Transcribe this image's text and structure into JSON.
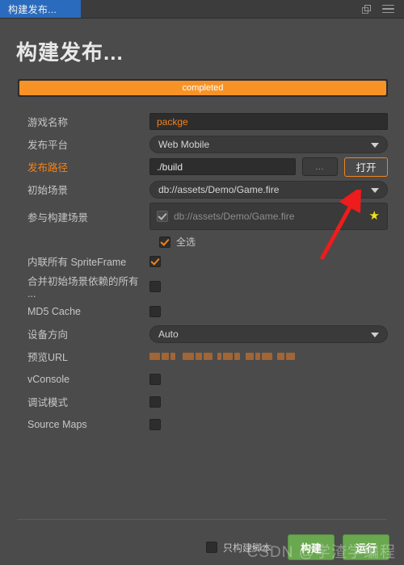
{
  "window": {
    "tab_label": "构建发布...",
    "popout_icon": "popout-icon",
    "menu_icon": "hamburger-menu-icon"
  },
  "header": {
    "title": "构建发布...",
    "progress": {
      "label": "completed",
      "percent": 100,
      "color": "#f79326"
    }
  },
  "form": {
    "game_name": {
      "label": "游戏名称",
      "value": "packge"
    },
    "platform": {
      "label": "发布平台",
      "value": "Web Mobile"
    },
    "build_path": {
      "label": "发布路径",
      "value": "./build",
      "browse_label": "...",
      "open_label": "打开",
      "label_color": "#f0821e"
    },
    "start_scene": {
      "label": "初始场景",
      "value": "db://assets/Demo/Game.fire"
    },
    "included_scenes": {
      "label": "参与构建场景",
      "items": [
        {
          "name": "db://assets/Demo/Game.fire",
          "checked": true,
          "starred": true
        }
      ],
      "select_all_label": "全选",
      "select_all_checked": true
    },
    "inline_spriteframe": {
      "label": "内联所有 SpriteFrame",
      "checked": true
    },
    "merge_deps": {
      "label": "合并初始场景依赖的所有 ...",
      "checked": false
    },
    "md5_cache": {
      "label": "MD5 Cache",
      "checked": false
    },
    "orientation": {
      "label": "设备方向",
      "value": "Auto"
    },
    "preview_url": {
      "label": "预览URL",
      "value": "",
      "redacted": true
    },
    "vconsole": {
      "label": "vConsole",
      "checked": false
    },
    "debug_mode": {
      "label": "调试模式",
      "checked": false
    },
    "source_maps": {
      "label": "Source Maps",
      "checked": false
    }
  },
  "footer": {
    "scripts_only": {
      "label": "只构建脚本",
      "checked": false
    },
    "build_label": "构建",
    "run_label": "运行",
    "button_color": "#6aa84f"
  },
  "annotation": {
    "arrow_color": "#ee1c1c",
    "points_to": "打开"
  },
  "watermark": "CSDN @学渣学编程"
}
